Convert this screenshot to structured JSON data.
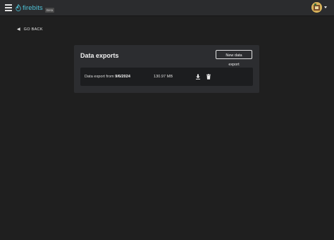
{
  "app": {
    "logo_text": "firebits",
    "beta_label": "Beta",
    "brand_color": "#4fc3d8"
  },
  "nav": {
    "go_back_label": "GO BACK"
  },
  "exports": {
    "title": "Data exports",
    "new_button_label": "New data export",
    "items": [
      {
        "prefix": "Data export from ",
        "date": "9/6/2024",
        "size": "130.97 MB",
        "actions": [
          "download-icon",
          "delete-icon"
        ]
      }
    ]
  },
  "icons": {
    "menu": "hamburger-icon",
    "back": "chevron-left-icon",
    "account": "avatar",
    "account_menu": "caret-down-icon"
  }
}
